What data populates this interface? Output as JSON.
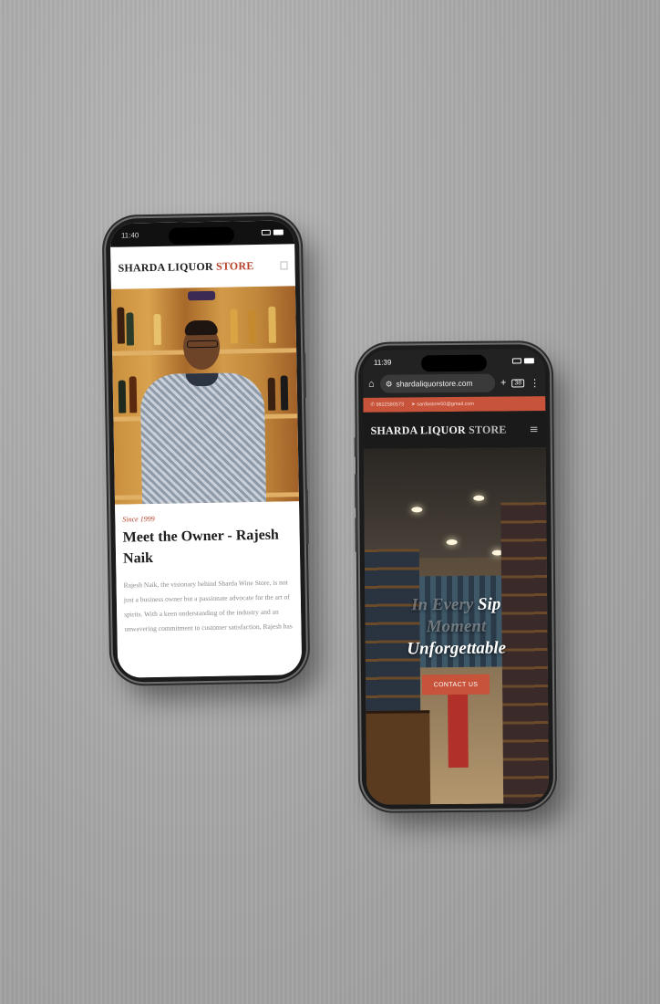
{
  "phone_left": {
    "status": {
      "time": "11:40"
    },
    "header": {
      "logo_primary": "SHARDA LIQUOR",
      "logo_accent": "STORE"
    },
    "about": {
      "eyebrow": "Since 1999",
      "title": "Meet the Owner - Rajesh Naik",
      "body": "Rajesh Naik, the visionary behind Sharda Wine Store, is not just a business owner but a passionate advocate for the art of spirits. With a keen understanding of the industry and an unwavering commitment to customer satisfaction, Rajesh has"
    }
  },
  "phone_right": {
    "status": {
      "time": "11:39"
    },
    "browser": {
      "url": "shardaliquorstore.com",
      "tab_count": "38"
    },
    "topbar": {
      "phone": "9822580573",
      "email": "sardastore50@gmail.com"
    },
    "header": {
      "logo_primary": "SHARDA LIQUOR",
      "logo_accent": "STORE"
    },
    "hero": {
      "line1_faint": "In Every",
      "line1": "Sip",
      "line2_faint": "Moment",
      "line3": "Unforgettable",
      "cta_label": "CONTACT US"
    }
  },
  "colors": {
    "accent": "#c7533a",
    "logo_accent": "#b8432b",
    "dark_header": "#1a1a1a"
  },
  "icons": [
    "menu-icon",
    "hamburger-icon",
    "home-icon",
    "site-info-icon",
    "plus-icon",
    "tabs-icon",
    "more-icon",
    "phone-icon",
    "mail-icon"
  ]
}
